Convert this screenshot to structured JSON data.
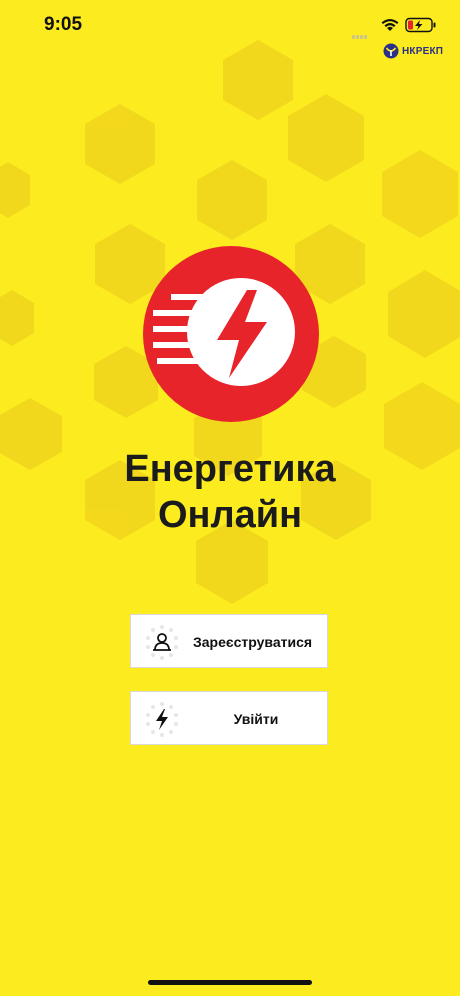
{
  "status_bar": {
    "time": "9:05"
  },
  "regulator": {
    "label": "НКРЕКП"
  },
  "app": {
    "title_line1": "Енергетика",
    "title_line2": "Онлайн"
  },
  "buttons": {
    "register_label": "Зареєструватися",
    "login_label": "Увійти"
  },
  "colors": {
    "background": "#FCEC1F",
    "hexagon": "#F5DC1A",
    "logo_red": "#E8242B",
    "button_bg": "#FFFFFF"
  }
}
